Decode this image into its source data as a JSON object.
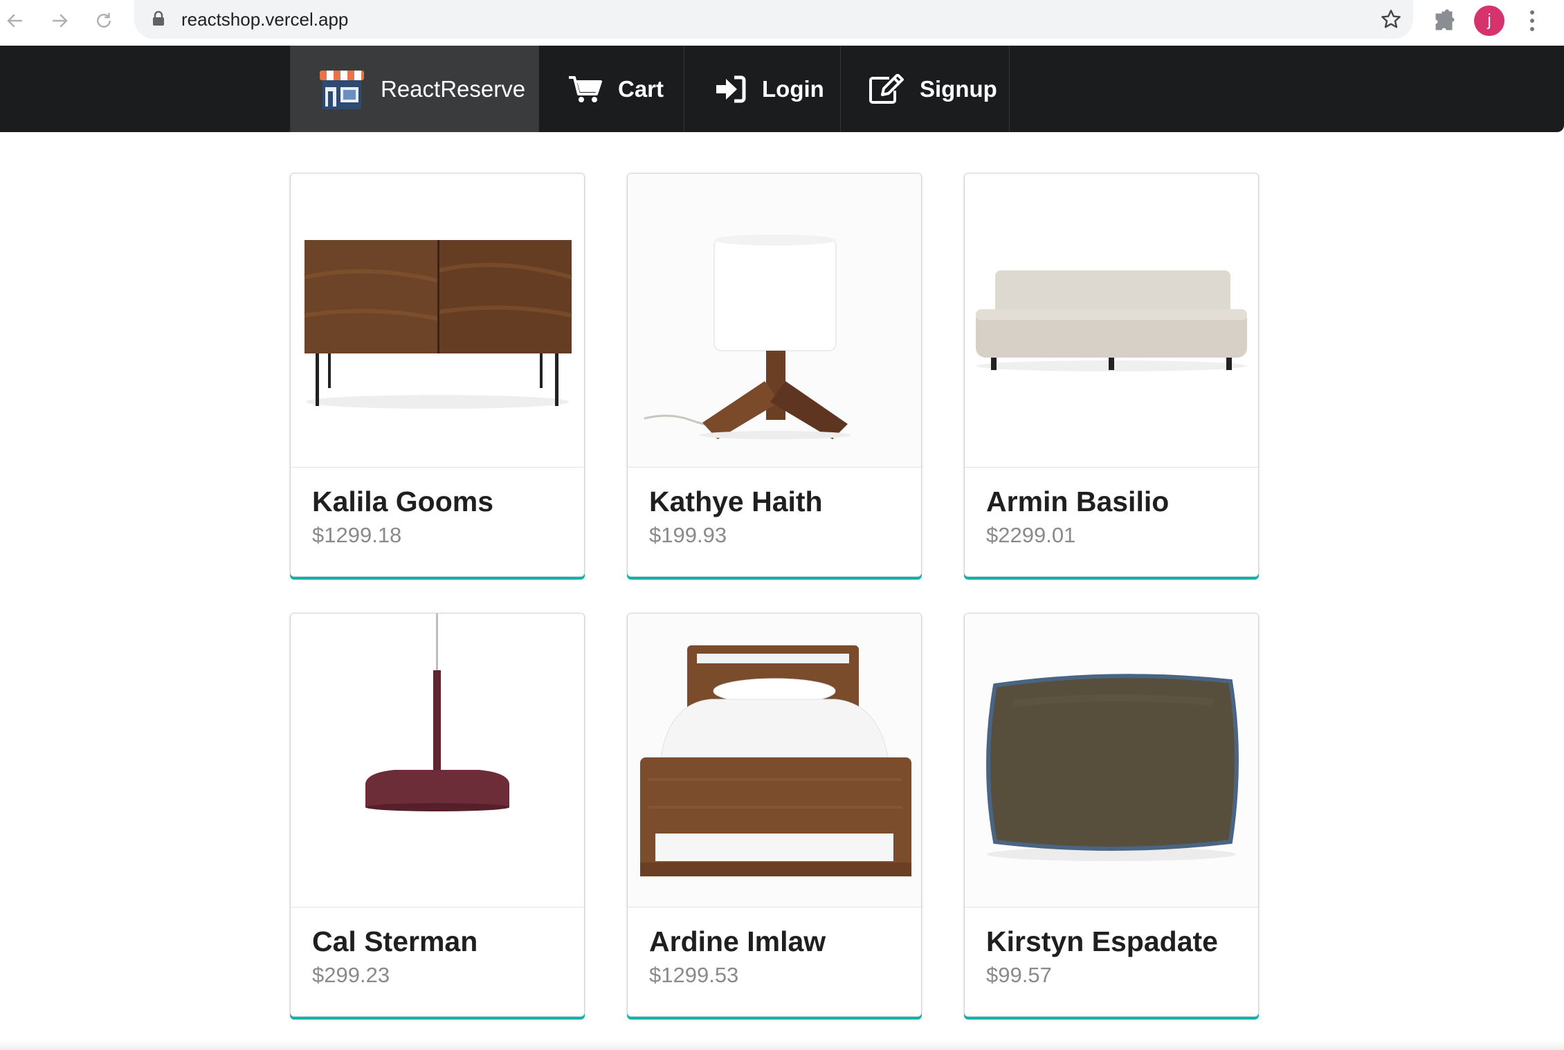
{
  "browser": {
    "url": "reactshop.vercel.app",
    "profile_initial": "j",
    "profile_color": "#d6336c"
  },
  "menu": {
    "brand": "ReactReserve",
    "items": [
      {
        "label": "Cart",
        "icon": "cart-icon"
      },
      {
        "label": "Login",
        "icon": "sign-in-icon"
      },
      {
        "label": "Signup",
        "icon": "edit-icon"
      }
    ],
    "accent": "#00b5ad"
  },
  "products": [
    {
      "name": "Kalila Gooms",
      "price": "$1299.18",
      "image": "walnut-credenza"
    },
    {
      "name": "Kathye Haith",
      "price": "$199.93",
      "image": "table-lamp"
    },
    {
      "name": "Armin Basilio",
      "price": "$2299.01",
      "image": "sofa"
    },
    {
      "name": "Cal Sterman",
      "price": "$299.23",
      "image": "pendant-lamp"
    },
    {
      "name": "Ardine Imlaw",
      "price": "$1299.53",
      "image": "wooden-bed"
    },
    {
      "name": "Kirstyn Espadate",
      "price": "$99.57",
      "image": "throw-pillow"
    }
  ]
}
